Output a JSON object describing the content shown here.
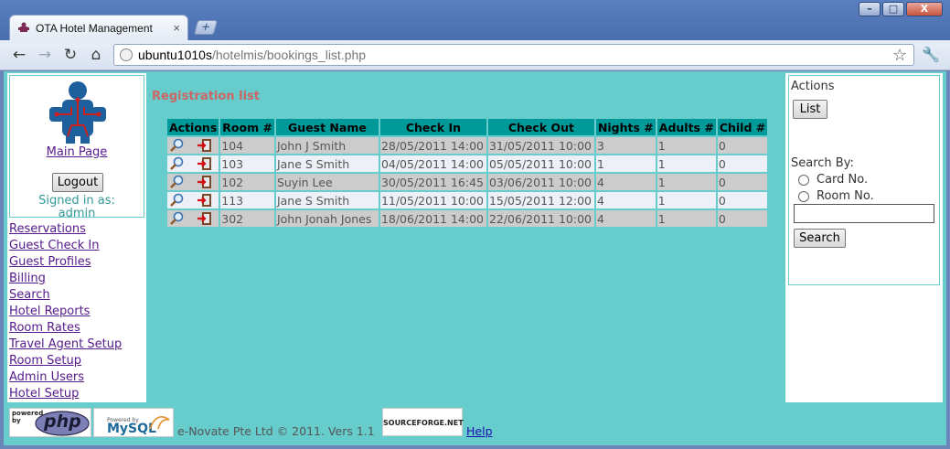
{
  "browser": {
    "tab_title": "OTA Hotel Management",
    "tab_close": "×",
    "new_tab": "+",
    "url_host": "ubuntu1010s",
    "url_path": "/hotelmis/bookings_list.php",
    "window_buttons": [
      "–",
      "□",
      "X"
    ],
    "nav_icons": [
      "back-arrow-icon",
      "forward-arrow-icon",
      "reload-icon",
      "home-icon"
    ]
  },
  "left": {
    "main_page": "Main Page",
    "logout": "Logout",
    "signed_in_as": "Signed in as:",
    "username": "admin",
    "menu": [
      "Reservations",
      "Guest Check In",
      "Guest Profiles",
      "Billing",
      "Search",
      "Hotel Reports",
      "Room Rates",
      "Travel Agent Setup",
      "Room Setup",
      "Admin Users",
      "Hotel Setup"
    ]
  },
  "main": {
    "title": "Registration list",
    "columns": [
      "Actions",
      "Room #",
      "Guest Name",
      "Check In",
      "Check Out",
      "Nights #",
      "Adults #",
      "Child #"
    ],
    "rows": [
      [
        "104",
        "John J Smith",
        "28/05/2011 14:00",
        "31/05/2011 10:00",
        "3",
        "1",
        "0"
      ],
      [
        "103",
        "Jane S Smith",
        "04/05/2011 14:00",
        "05/05/2011 10:00",
        "1",
        "1",
        "0"
      ],
      [
        "102",
        "Suyin Lee",
        "30/05/2011 16:45",
        "03/06/2011 10:00",
        "4",
        "1",
        "0"
      ],
      [
        "113",
        "Jane S Smith",
        "11/05/2011 10:00",
        "15/05/2011 12:00",
        "4",
        "1",
        "0"
      ],
      [
        "302",
        "John Jonah Jones",
        "18/06/2011 14:00",
        "22/06/2011 10:00",
        "4",
        "1",
        "0"
      ]
    ]
  },
  "right": {
    "actions_label": "Actions",
    "list_button": "List",
    "search_by": "Search By:",
    "option_card": "Card No.",
    "option_room": "Room No.",
    "search_value": "",
    "search_button": "Search"
  },
  "footer": {
    "copyright": "e-Novate Pte Ltd © 2011. Vers 1.1",
    "help": "Help",
    "php_badge_top": "powered by",
    "php_badge": "php",
    "mysql_badge_top": "Powered by",
    "mysql_badge": "MySQL",
    "sf_badge": "SOURCEFORGE.NET"
  }
}
